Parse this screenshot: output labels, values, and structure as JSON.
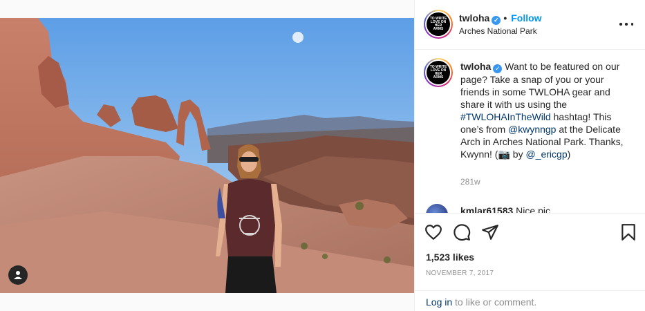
{
  "post": {
    "username": "twloha",
    "verified_mark": "✓",
    "separator": "•",
    "follow_label": "Follow",
    "location": "Arches National Park",
    "avatar_text": "TO WRITE LOVE ON HER ARMS"
  },
  "caption": {
    "username": "twloha",
    "text_1": " Want to be featured on our page? Take a snap of you or your friends in some TWLOHA gear and share it with us using the ",
    "hashtag": "#TWLOHAInTheWild",
    "text_2": " hashtag! This one’s from ",
    "mention_1": "@kwynngp",
    "text_3": " at the Delicate Arch in Arches National Park. Thanks, Kwynn! (",
    "camera_emoji": "📷",
    "text_4": " by ",
    "mention_2": "@_ericgp",
    "text_5": ")",
    "timestamp": "281w"
  },
  "comment_2": {
    "username": "kmlar61583",
    "text": " Nice pic"
  },
  "stats": {
    "likes": "1,523 likes",
    "date": "NOVEMBER 7, 2017"
  },
  "login": {
    "link": "Log in",
    "text": " to like or comment."
  },
  "icons": {
    "like": "heart-icon",
    "comment": "comment-icon",
    "share": "share-icon",
    "save": "bookmark-icon",
    "more": "more-options-icon",
    "user_tag": "user-tag-icon"
  },
  "colors": {
    "accent": "#0095f6",
    "link": "#00376b",
    "muted": "#8e8e8e",
    "verified": "#3897f0"
  }
}
